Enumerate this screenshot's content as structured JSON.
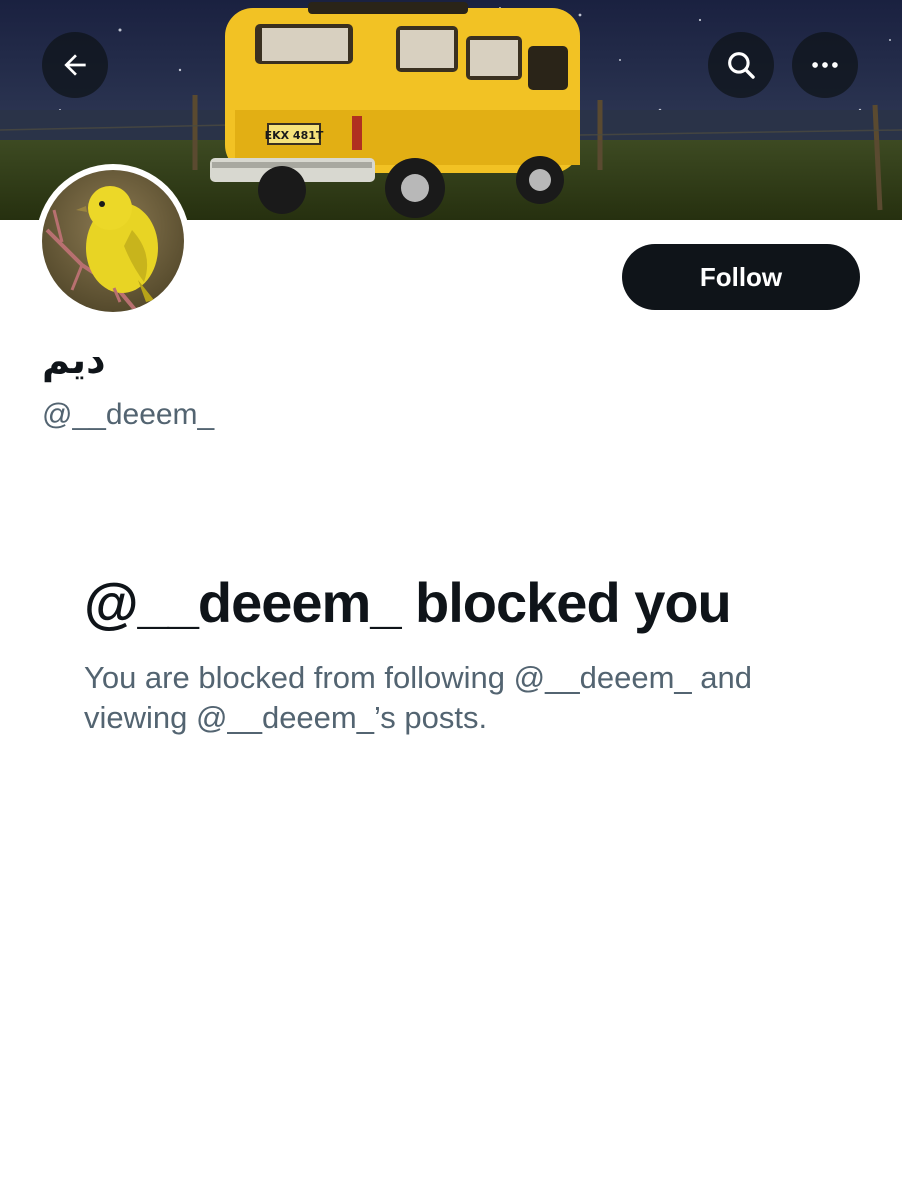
{
  "header": {
    "back_icon": "arrow-left-icon",
    "search_icon": "search-icon",
    "more_icon": "more-horizontal-icon"
  },
  "banner": {
    "van_plate": "EKX 481T",
    "van_color": "#f2c224"
  },
  "profile": {
    "display_name": "ديم",
    "handle": "@__deeem_",
    "follow_label": "Follow"
  },
  "blocked": {
    "title": "@__deeem_ blocked you",
    "description": "You are blocked from following @__deeem_ and viewing @__deeem_’s posts."
  },
  "colors": {
    "primary_text": "#0f1419",
    "secondary_text": "#536471",
    "follow_button_bg": "#0f1419",
    "background": "#ffffff"
  }
}
